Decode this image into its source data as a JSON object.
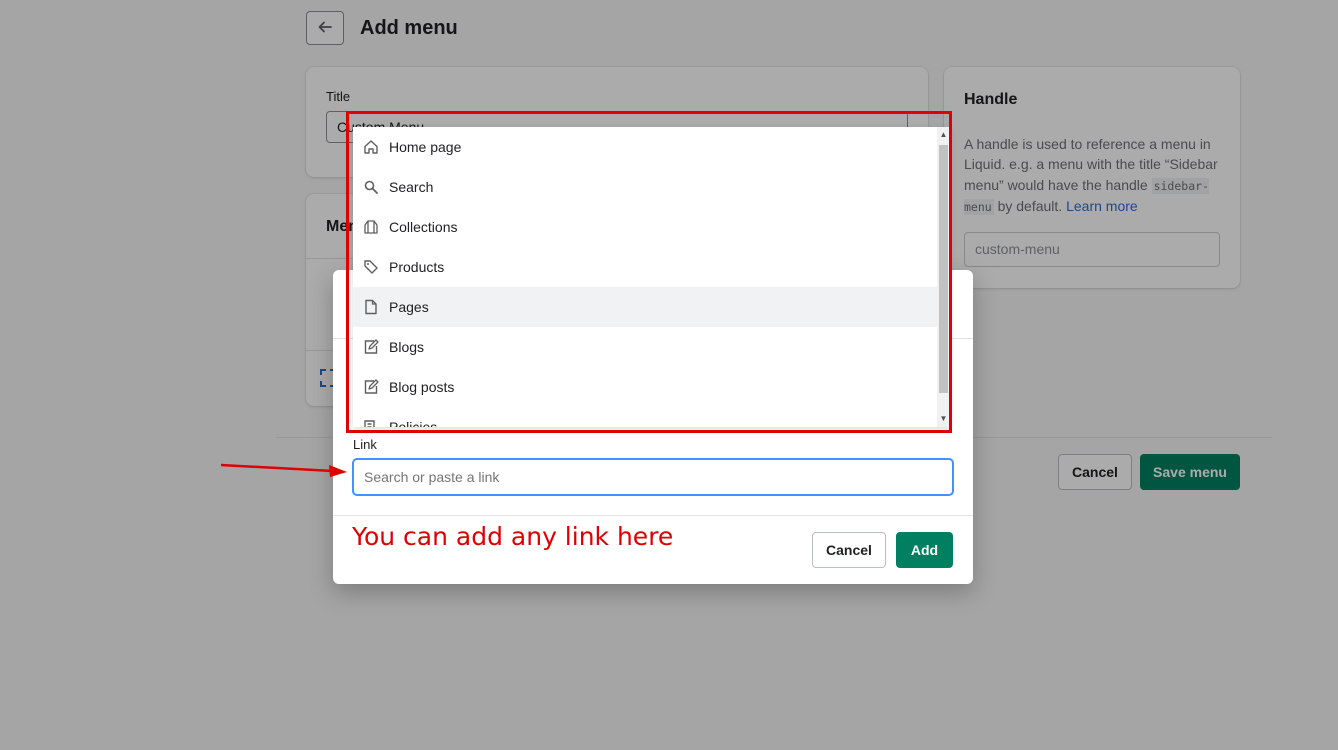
{
  "page": {
    "title": "Add menu",
    "title_card": {
      "label": "Title",
      "value": "Custom Menu"
    },
    "menu_card": {
      "heading": "Menu items"
    },
    "handle_card": {
      "heading": "Handle",
      "desc_1": "A handle is used to reference a menu in Liquid. e.g. a menu with the title “Sidebar menu” would have the handle ",
      "code": "sidebar-menu",
      "desc_2": " by default. ",
      "learn_more": "Learn more",
      "input_placeholder": "custom-menu"
    },
    "actions": {
      "cancel": "Cancel",
      "save": "Save menu"
    }
  },
  "modal": {
    "link_label": "Link",
    "link_placeholder": "Search or paste a link",
    "cancel": "Cancel",
    "add": "Add"
  },
  "dropdown": {
    "items": [
      {
        "label": "Home page",
        "icon": "home-icon"
      },
      {
        "label": "Search",
        "icon": "search-icon"
      },
      {
        "label": "Collections",
        "icon": "collections-icon"
      },
      {
        "label": "Products",
        "icon": "tag-icon"
      },
      {
        "label": "Pages",
        "icon": "page-icon"
      },
      {
        "label": "Blogs",
        "icon": "edit-icon"
      },
      {
        "label": "Blog posts",
        "icon": "edit-icon"
      },
      {
        "label": "Policies",
        "icon": "policy-icon"
      }
    ],
    "highlighted_index": 4
  },
  "annotation": {
    "text": "You can add any link here",
    "color": "#e00000"
  },
  "colors": {
    "primary": "#008060",
    "focus": "#458fff",
    "link": "#2c6ecb"
  }
}
